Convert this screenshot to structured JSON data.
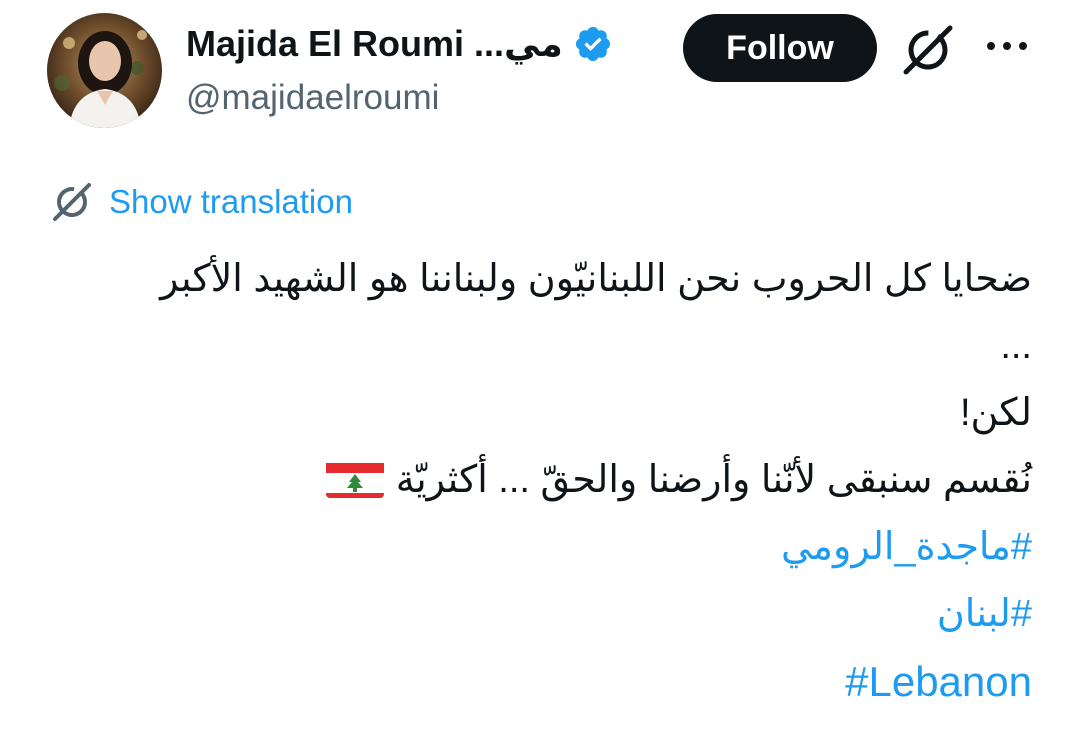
{
  "author": {
    "display_name": "Majida El Roumi ...مي",
    "handle": "@majidaelroumi",
    "verified_icon": "verified-badge-icon",
    "avatar_icon": "avatar"
  },
  "header": {
    "follow_label": "Follow",
    "grok_icon": "grok-icon",
    "more_icon": "more-icon"
  },
  "translation": {
    "icon": "translate-icon",
    "label": "Show translation"
  },
  "tweet": {
    "lines": [
      "ضحايا كل الحروب نحن اللبنانيّون ولبناننا هو الشهيد الأكبر",
      "...",
      "لكن!",
      "نُقسم سنبقى لأنّنا وأرضنا والحقّ ... أكثريّة"
    ],
    "flag_emoji": "lebanon-flag",
    "hashtags": [
      "#ماجدة_الرومي",
      "#لبنان",
      "#Lebanon"
    ]
  },
  "colors": {
    "accent": "#1d9bf0",
    "text": "#0f1419",
    "secondary": "#536471",
    "button_bg": "#0f1419",
    "flag_red": "#e62b2f",
    "cedar_green": "#2e8b3a"
  }
}
